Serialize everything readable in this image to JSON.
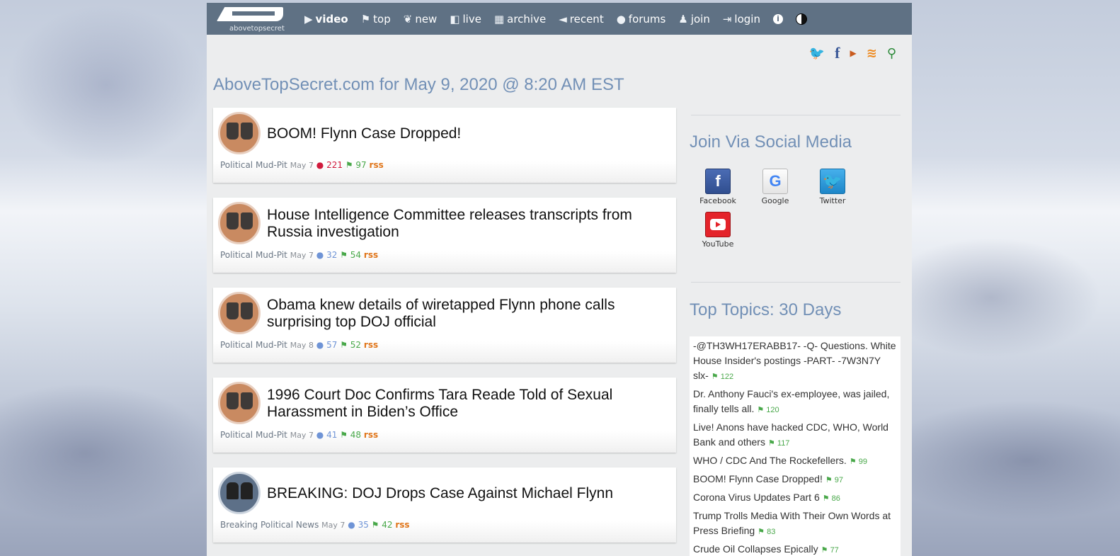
{
  "header": {
    "logo_text": "abovetopsecret",
    "nav": [
      {
        "label": "video",
        "icon": "video-camera-icon",
        "glyph": "▶"
      },
      {
        "label": "top",
        "icon": "flag-icon",
        "glyph": "⚑"
      },
      {
        "label": "new",
        "icon": "leaf-icon",
        "glyph": "❦"
      },
      {
        "label": "live",
        "icon": "comment-icon",
        "glyph": "◧"
      },
      {
        "label": "archive",
        "icon": "calendar-icon",
        "glyph": "▦"
      },
      {
        "label": "recent",
        "icon": "megaphone-icon",
        "glyph": "◄"
      },
      {
        "label": "forums",
        "icon": "comments-icon",
        "glyph": "●"
      },
      {
        "label": "join",
        "icon": "user-icon",
        "glyph": "♟"
      },
      {
        "label": "login",
        "icon": "login-icon",
        "glyph": "⇥"
      }
    ],
    "info_glyph": "i"
  },
  "social": {
    "twitter": "🐦",
    "facebook": "f",
    "youtube": "▶",
    "rss": "≋",
    "search": "⚲"
  },
  "page_title": "AboveTopSecret.com for May 9, 2020 @ 8:20 AM EST",
  "posts": [
    {
      "title": "BOOM! Flynn Case Dropped!",
      "forum": "Political Mud-Pit",
      "date": "May 7",
      "comments": "221",
      "flags": "97",
      "rss": "rss",
      "hot": true
    },
    {
      "title": "House Intelligence Committee releases transcripts from Russia investigation",
      "forum": "Political Mud-Pit",
      "date": "May 7",
      "comments": "32",
      "flags": "54",
      "rss": "rss"
    },
    {
      "title": "Obama knew details of wiretapped Flynn phone calls surprising top DOJ official",
      "forum": "Political Mud-Pit",
      "date": "May 8",
      "comments": "57",
      "flags": "52",
      "rss": "rss"
    },
    {
      "title": "1996 Court Doc Confirms Tara Reade Told of Sexual Harassment in Biden’s Office",
      "forum": "Political Mud-Pit",
      "date": "May 7",
      "comments": "41",
      "flags": "48",
      "rss": "rss"
    },
    {
      "title": "BREAKING: DOJ Drops Case Against Michael Flynn",
      "forum": "Breaking Political News",
      "date": "May 7",
      "comments": "35",
      "flags": "42",
      "rss": "rss"
    }
  ],
  "sidebar": {
    "join_title": "Join Via Social Media",
    "join_buttons": [
      {
        "label": "Facebook",
        "glyph": "f"
      },
      {
        "label": "Google",
        "glyph": "G"
      },
      {
        "label": "Twitter",
        "glyph": "🐦"
      },
      {
        "label": "YouTube",
        "glyph": ""
      }
    ],
    "topics_title": "Top Topics: 30 Days",
    "topics": [
      {
        "title": "-@TH3WH17ERABB17- -Q- Questions. White House Insider's postings -PART- -7W3N7Y slx-",
        "count": "122"
      },
      {
        "title": "Dr. Anthony Fauci's ex-employee, was jailed, finally tells all.",
        "count": "120"
      },
      {
        "title": "Live! Anons have hacked CDC, WHO, World Bank and others",
        "count": "117"
      },
      {
        "title": "WHO / CDC And The Rockefellers.",
        "count": "99"
      },
      {
        "title": "BOOM! Flynn Case Dropped!",
        "count": "97"
      },
      {
        "title": "Corona Virus Updates Part 6",
        "count": "86"
      },
      {
        "title": "Trump Trolls Media With Their Own Words at Press Briefing",
        "count": "83"
      },
      {
        "title": "Crude Oil Collapses Epically",
        "count": "77"
      }
    ]
  },
  "colors": {
    "nav_bg": "#5f7184",
    "heading_blue": "#7290b6",
    "flag_green": "#49a84a",
    "comment_blue": "#6f94d6",
    "comment_hot": "#d01a3c",
    "rss_orange": "#e0761b"
  }
}
